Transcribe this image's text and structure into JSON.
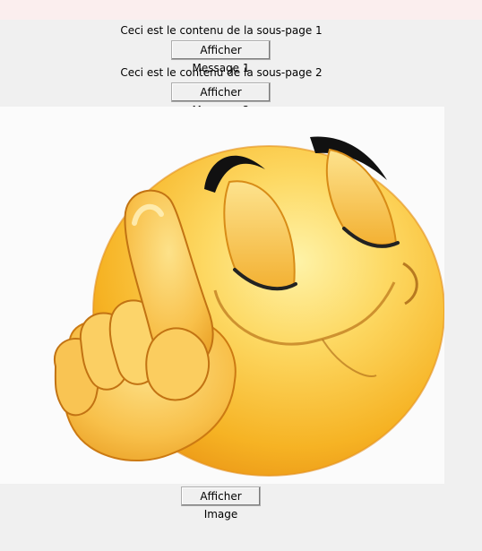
{
  "subpage1": {
    "text": "Ceci est le contenu de la sous-page 1",
    "button": "Afficher Message 1"
  },
  "subpage2": {
    "text": "Ceci est le contenu de la sous-page 2",
    "button": "Afficher Message 2"
  },
  "image_button": "Afficher Image",
  "image": {
    "icon": "shush-emoji-icon",
    "face_color": "#f6b324",
    "highlight": "#fde890"
  }
}
